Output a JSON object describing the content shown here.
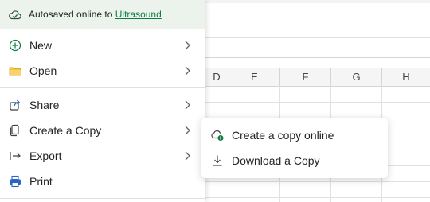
{
  "autosave": {
    "prefix": "Autosaved online to ",
    "location": "Ultrasound"
  },
  "menu": {
    "new": "New",
    "open": "Open",
    "share": "Share",
    "create_copy": "Create a Copy",
    "export": "Export",
    "print": "Print"
  },
  "submenu": {
    "create_online": "Create a copy online",
    "download": "Download a Copy"
  },
  "sheet": {
    "columns": [
      "D",
      "E",
      "F",
      "G",
      "H"
    ]
  },
  "colors": {
    "accent": "#107c41",
    "autosave_bg": "#ebf3ec"
  },
  "icons": [
    "cloud-check-icon",
    "plus-circle-icon",
    "folder-icon",
    "share-icon",
    "copy-icon",
    "export-icon",
    "printer-icon",
    "cloud-add-icon",
    "download-icon",
    "chevron-right-icon"
  ]
}
